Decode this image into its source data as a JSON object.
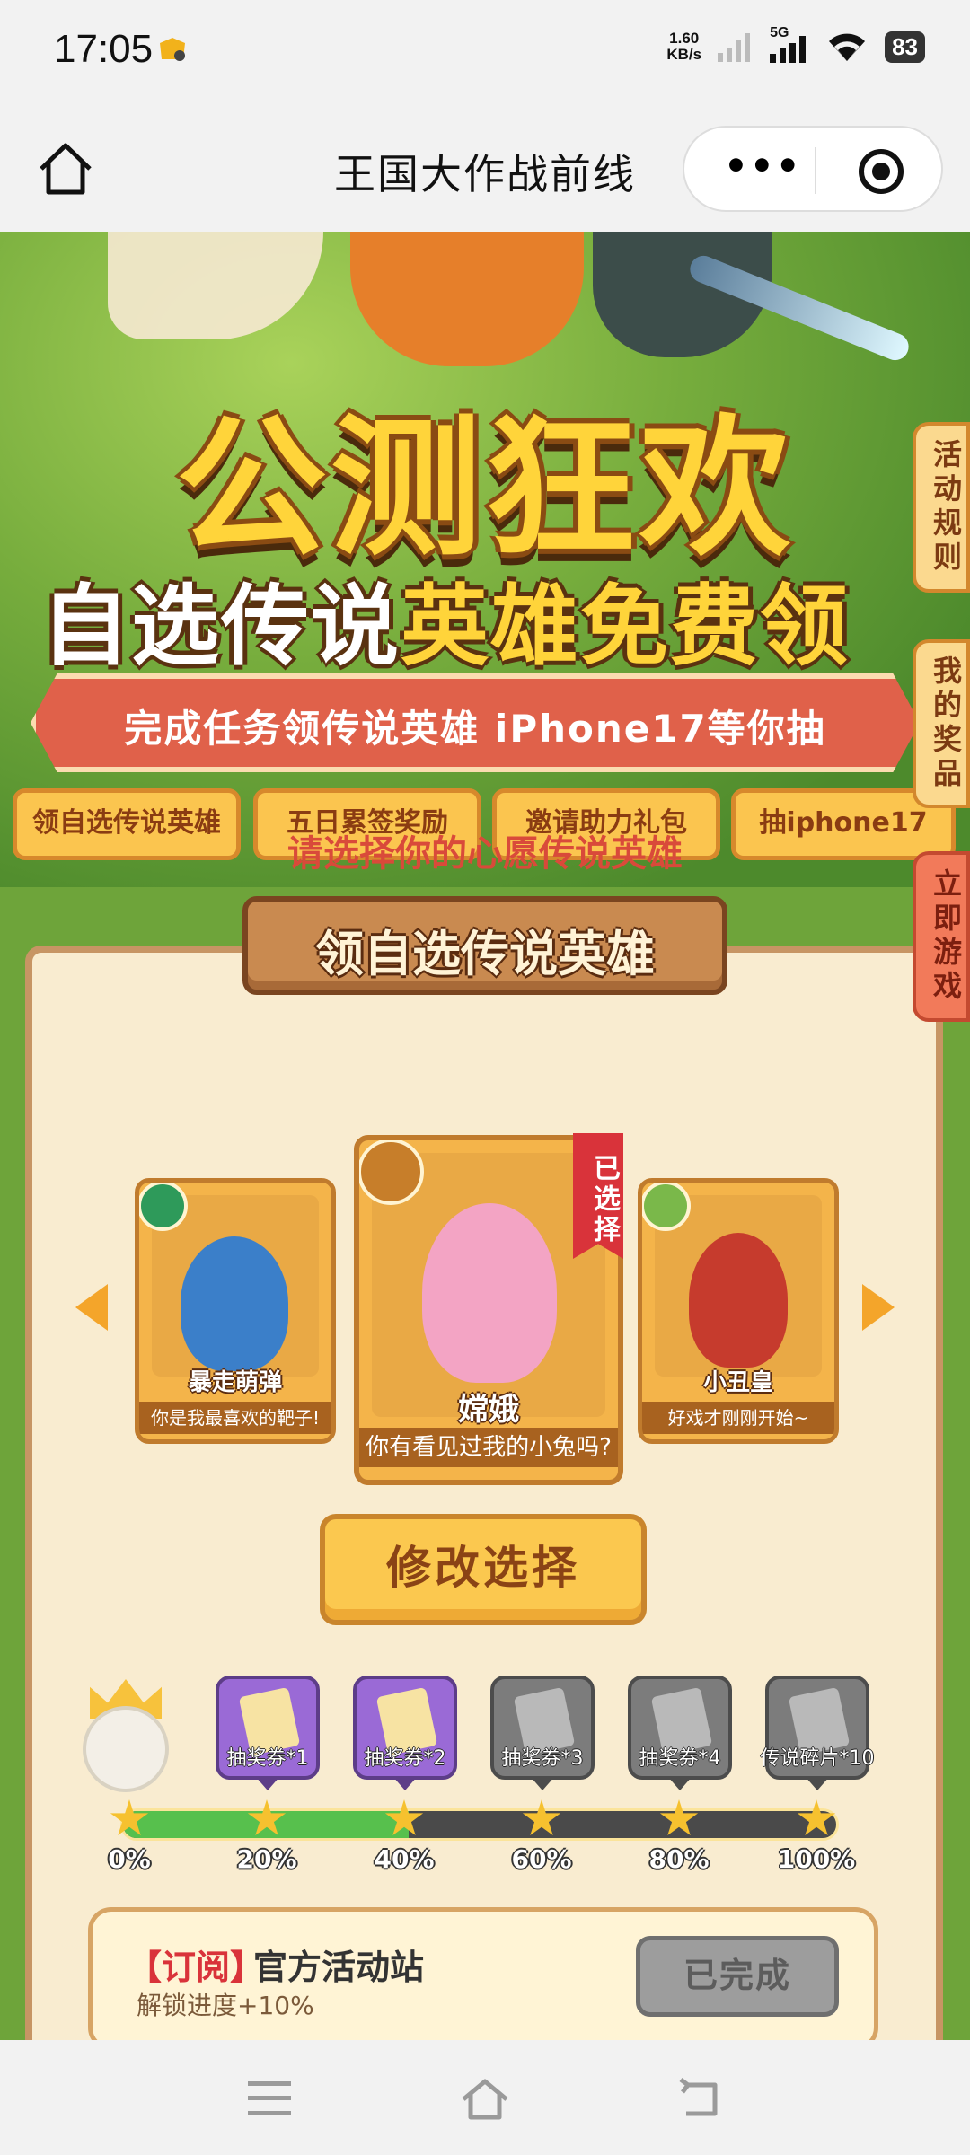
{
  "status_bar": {
    "time": "17:05",
    "net_speed_value": "1.60",
    "net_speed_unit": "KB/s",
    "signal_label": "5G",
    "battery": "83"
  },
  "nav": {
    "title": "王国大作战前线"
  },
  "banner": {
    "headline": "公测狂欢",
    "subline_white": "自选传说",
    "subline_yellow": "英雄免费领",
    "ribbon": "完成任务领传说英雄 iPhone17等你抽",
    "tabs": [
      "领自选传说英雄",
      "五日累签奖励",
      "邀请助力礼包",
      "抽iphone17"
    ]
  },
  "side_buttons": [
    "活动规则",
    "我的奖品",
    "立即游戏"
  ],
  "section": {
    "title": "领自选传说英雄",
    "prompt": "请选择你的心愿传说英雄",
    "heroes": [
      {
        "name": "暴走萌弹",
        "quote": "你是我最喜欢的靶子!"
      },
      {
        "name": "嫦娥",
        "quote": "你有看见过我的小兔吗?"
      },
      {
        "name": "小丑皇",
        "quote": "好戏才刚刚开始~"
      }
    ],
    "selected_tag": "已选择",
    "modify_button": "修改选择"
  },
  "progress": {
    "value_percent": 40,
    "rewards": [
      "抽奖券*1",
      "抽奖券*2",
      "抽奖券*3",
      "抽奖券*4",
      "传说碎片*10"
    ],
    "marks": [
      "0%",
      "20%",
      "40%",
      "60%",
      "80%",
      "100%"
    ]
  },
  "task": {
    "tag": "【订阅】",
    "title": "官方活动站",
    "subtitle": "解锁进度+10%",
    "button": "已完成"
  },
  "colors": {
    "accent_red": "#d9333a",
    "gold": "#fbc84f",
    "progress_green": "#57c04d"
  }
}
